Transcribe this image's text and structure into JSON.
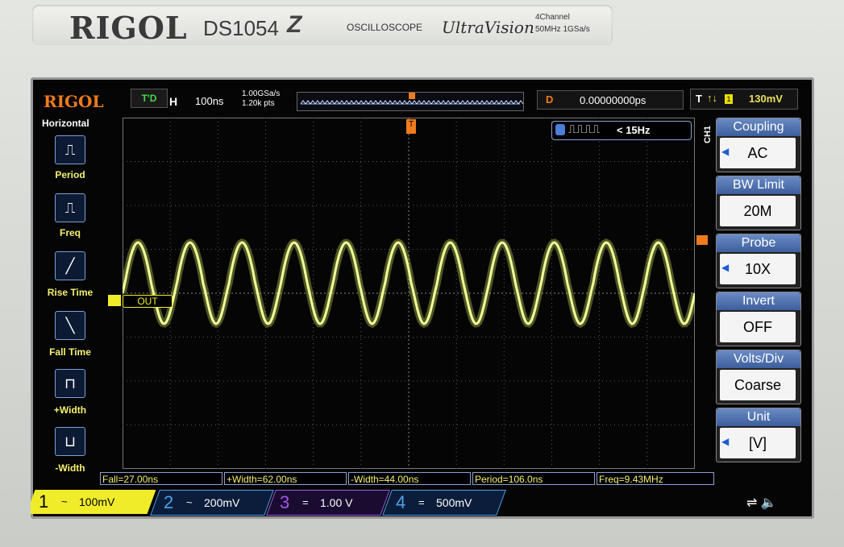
{
  "bezel": {
    "brand": "RIGOL",
    "model": "DS1054",
    "model_suffix": "Z",
    "product": "OSCILLOSCOPE",
    "tech": "UltraVision",
    "spec_line1": "4Channel",
    "spec_line2": "50MHz  1GSa/s"
  },
  "topbar": {
    "logo": "RIGOL",
    "run_state": "T'D",
    "h_label": "H",
    "timebase": "100ns",
    "sample_rate": "1.00GSa/s",
    "points": "1.20k pts",
    "delay_label": "D",
    "delay": "0.00000000ps",
    "trig_label": "T",
    "trig_slope": "↑↓",
    "trig_source": "1",
    "trig_level": "130mV"
  },
  "left_menu": {
    "header": "Horizontal",
    "items": [
      {
        "label": "Period",
        "icon": "period-icon"
      },
      {
        "label": "Freq",
        "icon": "freq-icon"
      },
      {
        "label": "Rise Time",
        "icon": "rise-time-icon"
      },
      {
        "label": "Fall Time",
        "icon": "fall-time-icon"
      },
      {
        "label": "+Width",
        "icon": "pos-width-icon"
      },
      {
        "label": "-Width",
        "icon": "neg-width-icon"
      }
    ]
  },
  "counter": {
    "value": "< 15Hz"
  },
  "channel_tag": "OUT",
  "trigger_marker": "T",
  "right_menu": {
    "channel": "CH1",
    "items": [
      {
        "title": "Coupling",
        "value": "AC",
        "arrow": true
      },
      {
        "title": "BW Limit",
        "value": "20M",
        "arrow": false
      },
      {
        "title": "Probe",
        "value": "10X",
        "arrow": true
      },
      {
        "title": "Invert",
        "value": "OFF",
        "arrow": false
      },
      {
        "title": "Volts/Div",
        "value": "Coarse",
        "arrow": false
      },
      {
        "title": "Unit",
        "value": "[V]",
        "arrow": true
      }
    ]
  },
  "measurements": [
    "Fall=27.00ns",
    "+Width=62.00ns",
    "-Width=44.00ns",
    "Period=106.0ns",
    "Freq=9.43MHz"
  ],
  "channels": [
    {
      "num": "1",
      "mode": "~",
      "scale": "100mV"
    },
    {
      "num": "2",
      "mode": "~",
      "scale": "200mV"
    },
    {
      "num": "3",
      "mode": "=",
      "scale": "1.00 V"
    },
    {
      "num": "4",
      "mode": "=",
      "scale": "500mV"
    }
  ],
  "colors": {
    "ch1": "#f0ec2a",
    "trace": "#d8f060",
    "accent_orange": "#f07b1c",
    "ch2": "#4da3e8",
    "ch3": "#a05ae8",
    "grid": "#5a5a5a"
  },
  "waveform": {
    "cycles": 11,
    "timebase_per_div": "100ns"
  }
}
